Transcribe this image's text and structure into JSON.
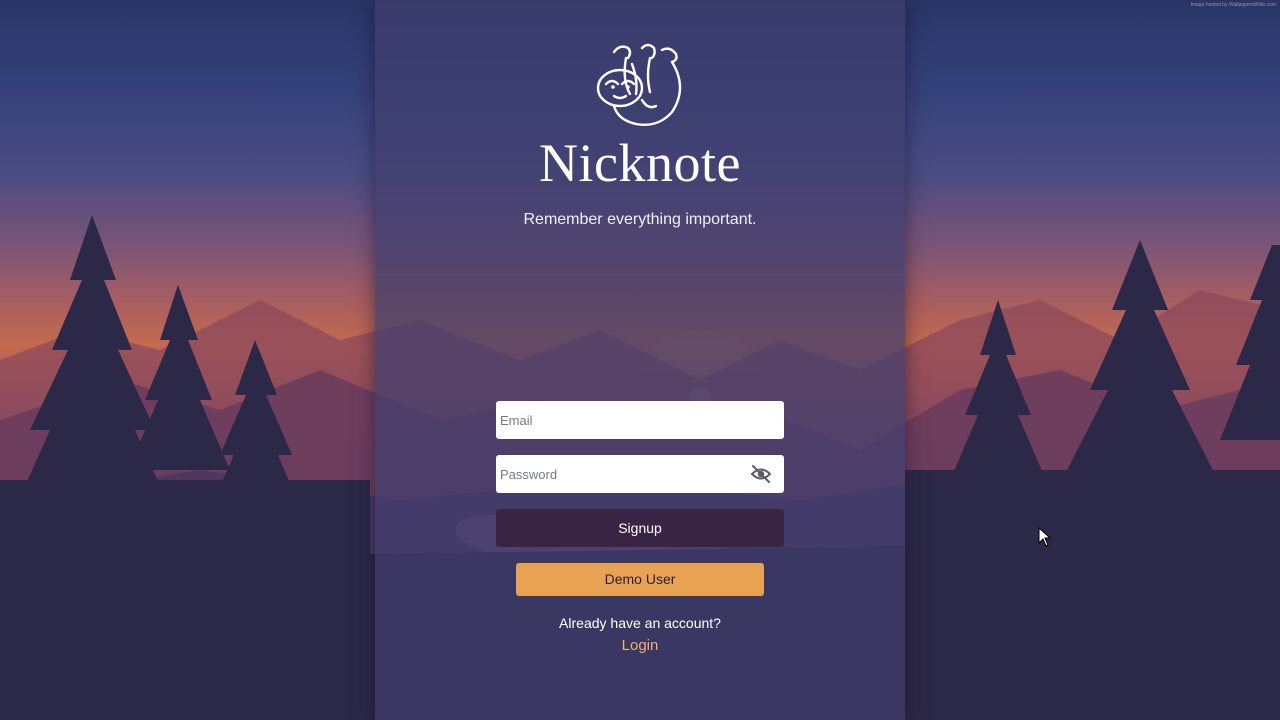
{
  "background": {
    "credit_text": "Image hosted by WallpapersWide.com"
  },
  "brand": {
    "logo_icon": "sloth-icon",
    "name": "Nicknote",
    "tagline": "Remember everything important."
  },
  "form": {
    "email_placeholder": "Email",
    "password_placeholder": "Password",
    "password_toggle_icon": "eye-slash-icon",
    "signup_label": "Signup",
    "demo_label": "Demo User"
  },
  "footer": {
    "already_text": "Already have an account?",
    "login_label": "Login"
  },
  "colors": {
    "panel": "#403e6e",
    "signup_button": "#3a2444",
    "demo_button": "#e8a352",
    "login_link": "#f0b070"
  }
}
